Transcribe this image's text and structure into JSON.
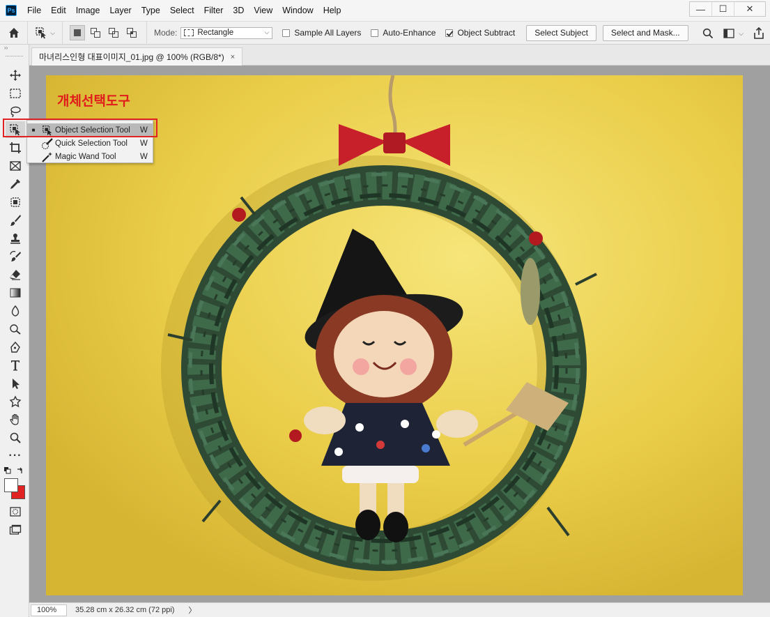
{
  "app": {
    "logo_text": "Ps"
  },
  "menu": [
    "File",
    "Edit",
    "Image",
    "Layer",
    "Type",
    "Select",
    "Filter",
    "3D",
    "View",
    "Window",
    "Help"
  ],
  "window_controls": {
    "minimize": "—",
    "restore": "☐",
    "close": "✕"
  },
  "options": {
    "mode_label": "Mode:",
    "mode_value": "Rectangle",
    "sample_all_layers": {
      "label": "Sample All Layers",
      "checked": false
    },
    "auto_enhance": {
      "label": "Auto-Enhance",
      "checked": false
    },
    "object_subtract": {
      "label": "Object Subtract",
      "checked": true
    },
    "select_subject": "Select Subject",
    "select_and_mask": "Select and Mask..."
  },
  "document": {
    "tab_title": "마녀리스인형 대표이미지_01.jpg @ 100% (RGB/8*)",
    "tab_close": "×"
  },
  "canvas": {
    "overlay_label": "개체선택도구"
  },
  "flyout": {
    "items": [
      {
        "name": "Object Selection Tool",
        "key": "W",
        "active": true
      },
      {
        "name": "Quick Selection Tool",
        "key": "W",
        "active": false
      },
      {
        "name": "Magic Wand Tool",
        "key": "W",
        "active": false
      }
    ]
  },
  "status": {
    "zoom": "100%",
    "doc_size": "35.28 cm x 26.32 cm (72 ppi)",
    "arrow": "〉"
  },
  "colors": {
    "foreground": "#ffffff",
    "background": "#e02222",
    "highlight_box": "#e02222"
  }
}
